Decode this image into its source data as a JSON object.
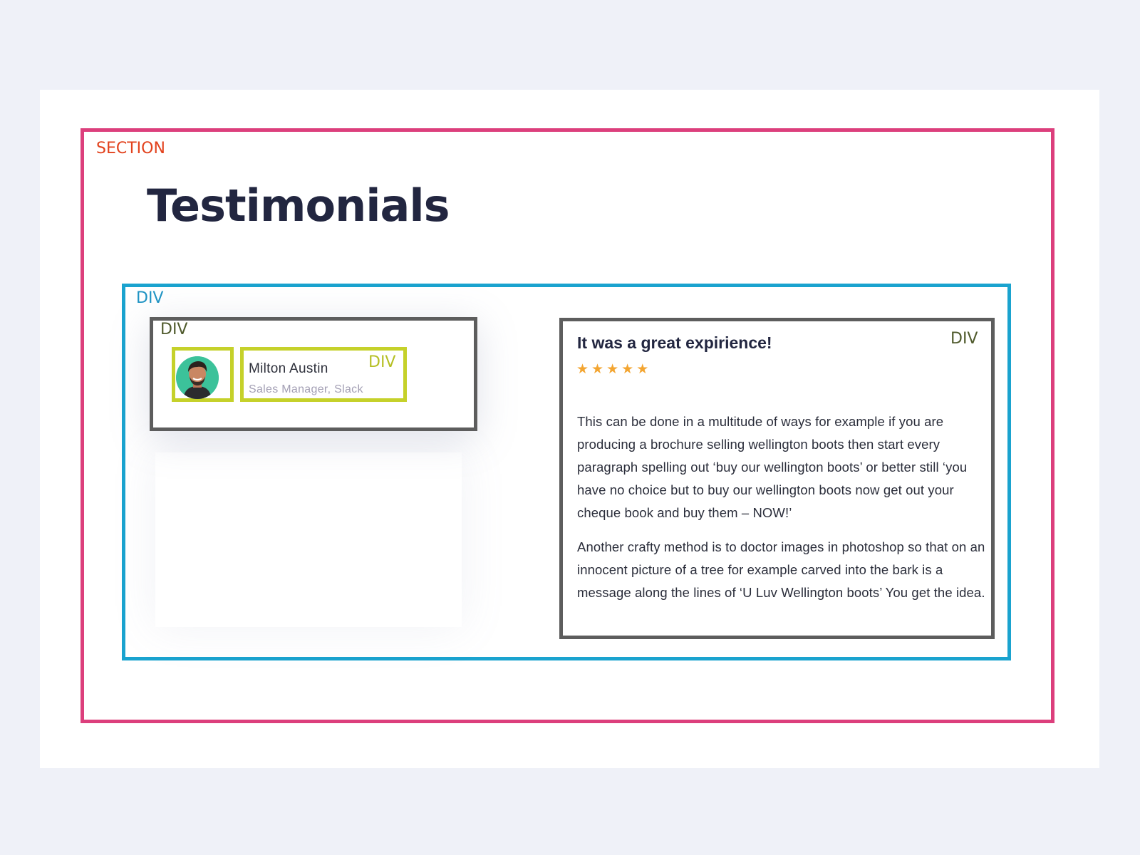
{
  "labels": {
    "section": "SECTION",
    "outer_div": "DIV",
    "author_div": "DIV",
    "meta_div": "DIV",
    "review_div": "DIV"
  },
  "page": {
    "title": "Testimonials"
  },
  "author": {
    "name": "Milton Austin",
    "role": "Sales Manager, Slack",
    "avatar_icon": "person-photo"
  },
  "review": {
    "title": "It was a great expirience!",
    "rating": 5,
    "rating_max": 5,
    "paragraphs": [
      "This can be done in a multitude of ways for example if you are producing a brochure selling wellington boots then start every paragraph spelling out ‘buy our wellington boots’ or better still ‘you have no choice but to buy our wellington boots now get out your cheque book and buy them – NOW!’",
      "Another crafty method is to doctor images in photoshop so that on an innocent picture of a tree for example carved into the bark is a message along the lines of ‘U Luv Wellington boots’ You get the idea."
    ]
  },
  "colors": {
    "section_border": "#dc3f7c",
    "section_label": "#e2421d",
    "outer_div_border": "#1aa3cf",
    "card_border": "#5d5d5d",
    "inner_div_border": "#c5d12a",
    "star": "#f3a531",
    "heading": "#222640",
    "background": "#eff1f8"
  }
}
